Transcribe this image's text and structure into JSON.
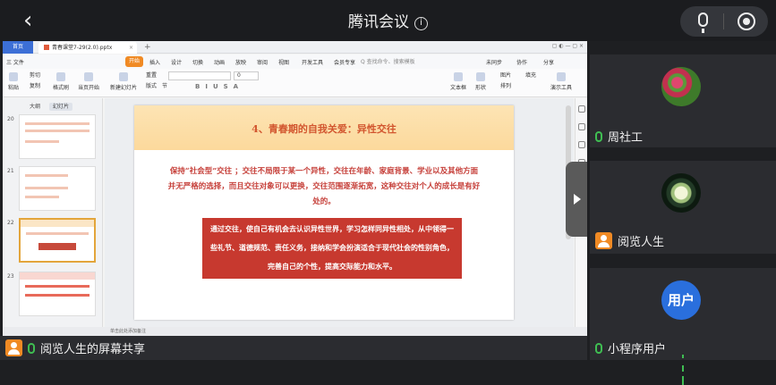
{
  "header": {
    "title": "腾讯会议",
    "info_icon": "info-icon",
    "back_icon": "back-arrow-icon"
  },
  "share": {
    "tabs": {
      "home": "首页",
      "file": "青春课堂7-29(2.0).pptx"
    },
    "menu": [
      "三 文件",
      "开始",
      "插入",
      "设计",
      "切换",
      "动画",
      "放映",
      "审阅",
      "视图",
      "开发工具",
      "会员专享"
    ],
    "active_menu": "开始",
    "search_placeholder": "Q 查找命令、搜索模板",
    "right_menu": [
      "未同步",
      "协作",
      "分享"
    ],
    "ribbon": [
      "粘贴",
      "剪切",
      "复制",
      "格式刷",
      "当页开始",
      "新建幻灯片",
      "版式",
      "节",
      "重置"
    ],
    "font_name": "",
    "font_size": "0",
    "ribbon_right": [
      "文本框",
      "形状",
      "排列",
      "图片",
      "填充",
      "演示工具"
    ],
    "left_panel_tabs": [
      "大纲",
      "幻灯片"
    ],
    "slide_numbers": [
      "20",
      "21",
      "22",
      "23"
    ],
    "selected_slide": "22",
    "status_text": "单击此处添加备注",
    "slide": {
      "title": "4、青春期的自我关爱：异性交往",
      "body": "保持“社会型”交往 ；交往不局限于某一个异性，交往在年龄、家庭背景、学业以及其他方面并无严格的选择，而且交往对象可以更换，交往范围逐渐拓宽，这种交往对个人的成长是有好处的。",
      "box": "通过交往，使自己有机会去认识异性世界，学习怎样同异性相处，从中领得一些礼节、道德规范、责任义务，接纳和学会扮演适合于现代社会的性别角色，完善自己的个性，提高交际能力和水平。"
    }
  },
  "participants": [
    {
      "name": "周社工",
      "avatar": "flower-avatar"
    },
    {
      "name": "阅览人生",
      "avatar": "lotus-avatar"
    },
    {
      "name": "小程序用户",
      "avatar_text": "用户"
    }
  ],
  "bottom": {
    "label": "阅览人生的屏幕共享"
  },
  "colors": {
    "accent": "#f08a24",
    "mic_active": "#3fbe52",
    "slide_title": "#d2562f",
    "slide_box": "#c7392f"
  }
}
